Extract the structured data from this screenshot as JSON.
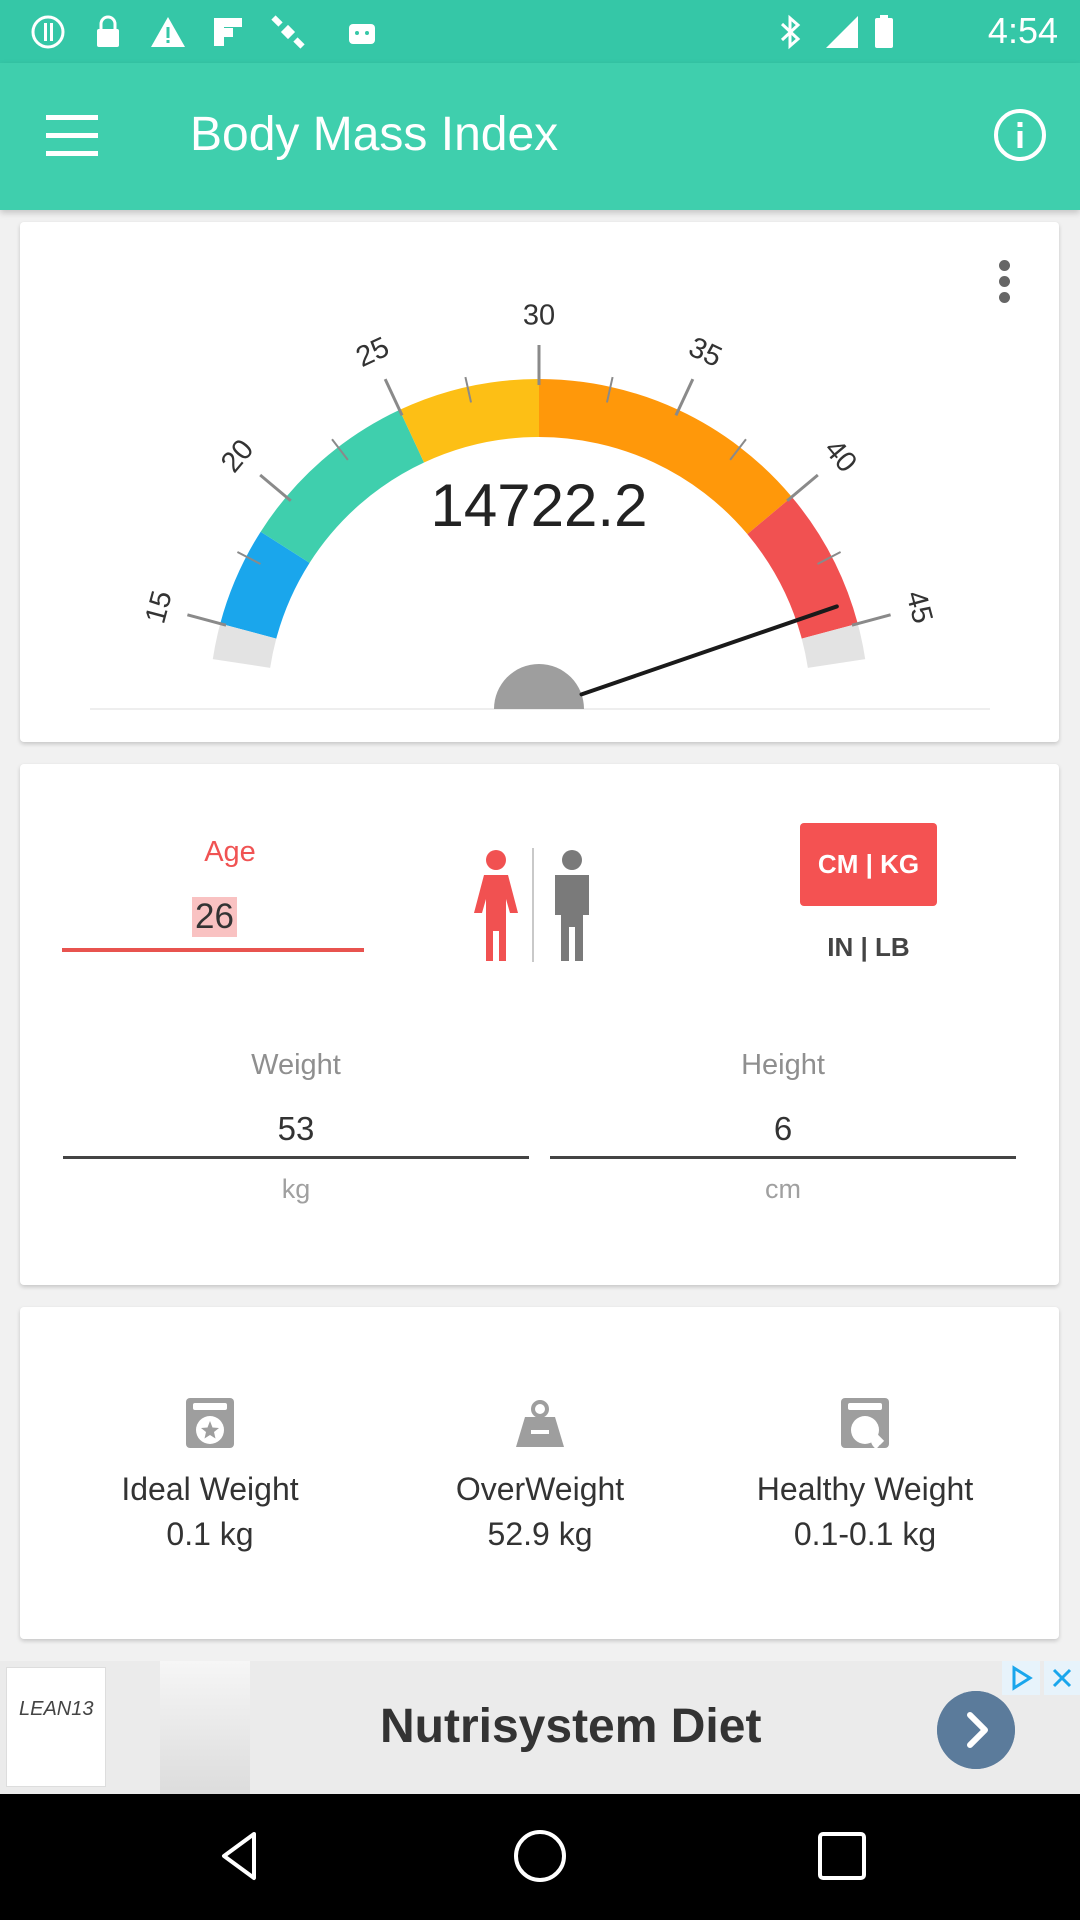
{
  "status_bar": {
    "time": "4:54",
    "icons": [
      "alert-circle-icon",
      "lock-icon",
      "warning-icon",
      "flipboard-icon",
      "satellite-icon",
      "android-icon",
      "bluetooth-icon",
      "signal-icon",
      "battery-icon"
    ]
  },
  "app_bar": {
    "title": "Body Mass Index",
    "menu_icon": "hamburger-menu-icon",
    "info_icon": "info-icon"
  },
  "gauge": {
    "value": "14722.2",
    "min": 15,
    "max": 45,
    "major_ticks": [
      "15",
      "20",
      "25",
      "30",
      "35",
      "40",
      "45"
    ],
    "needle_value": 44.2,
    "segments": [
      {
        "from": 15,
        "to": 18.5,
        "color": "#1aa6ec"
      },
      {
        "from": 18.5,
        "to": 25,
        "color": "#3fcfad"
      },
      {
        "from": 25,
        "to": 30,
        "color": "#fdbf15"
      },
      {
        "from": 30,
        "to": 40,
        "color": "#ff980a"
      },
      {
        "from": 40,
        "to": 45,
        "color": "#f15151"
      }
    ],
    "overflow_icon": "more-vert-icon"
  },
  "input": {
    "age_label": "Age",
    "age_value": "26",
    "gender_female_icon": "female-icon",
    "gender_male_icon": "male-icon",
    "unit_metric": "CM | KG",
    "unit_imperial": "IN | LB",
    "weight_label": "Weight",
    "weight_value": "53",
    "weight_unit": "kg",
    "height_label": "Height",
    "height_value": "6",
    "height_unit": "cm"
  },
  "results": [
    {
      "icon": "scale-star-icon",
      "label": "Ideal Weight",
      "value": "0.1 kg"
    },
    {
      "icon": "weight-icon",
      "label": "OverWeight",
      "value": "52.9 kg"
    },
    {
      "icon": "scale-heart-icon",
      "label": "Healthy Weight",
      "value": "0.1-0.1 kg"
    }
  ],
  "ad": {
    "logo_text": "LEAN13",
    "title": "Nutrisystem Diet"
  },
  "colors": {
    "primary": "#3fcfad",
    "status_bar": "#35c7a7",
    "accent": "#f45252"
  }
}
